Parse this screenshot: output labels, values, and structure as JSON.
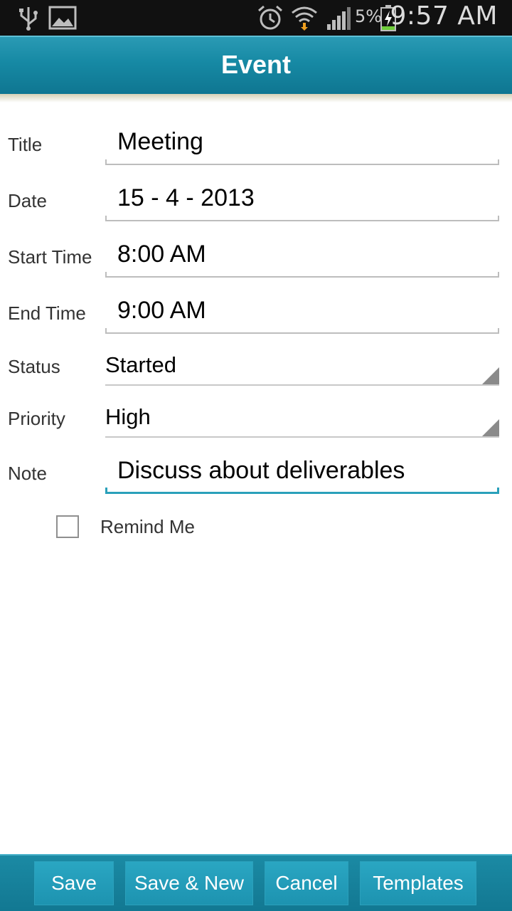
{
  "status_bar": {
    "battery_percent": "5%",
    "time": "9:57 AM",
    "icons": [
      "usb-icon",
      "image-icon",
      "alarm-icon",
      "wifi-icon",
      "signal-icon",
      "battery-charging-icon"
    ]
  },
  "header": {
    "title": "Event"
  },
  "form": {
    "title": {
      "label": "Title",
      "value": "Meeting"
    },
    "date": {
      "label": "Date",
      "value": "15 - 4 - 2013"
    },
    "start_time": {
      "label": "Start Time",
      "value": "8:00 AM"
    },
    "end_time": {
      "label": "End Time",
      "value": "9:00 AM"
    },
    "status": {
      "label": "Status",
      "value": "Started"
    },
    "priority": {
      "label": "Priority",
      "value": "High"
    },
    "note": {
      "label": "Note",
      "value": "Discuss about deliverables"
    }
  },
  "remind": {
    "label": "Remind Me",
    "checked": false
  },
  "toolbar": {
    "save": "Save",
    "save_new": "Save & New",
    "cancel": "Cancel",
    "templates": "Templates"
  },
  "colors": {
    "header": "#1689a4",
    "focus_underline": "#2aa0ba",
    "toolbar_button": "#1d93b0"
  }
}
